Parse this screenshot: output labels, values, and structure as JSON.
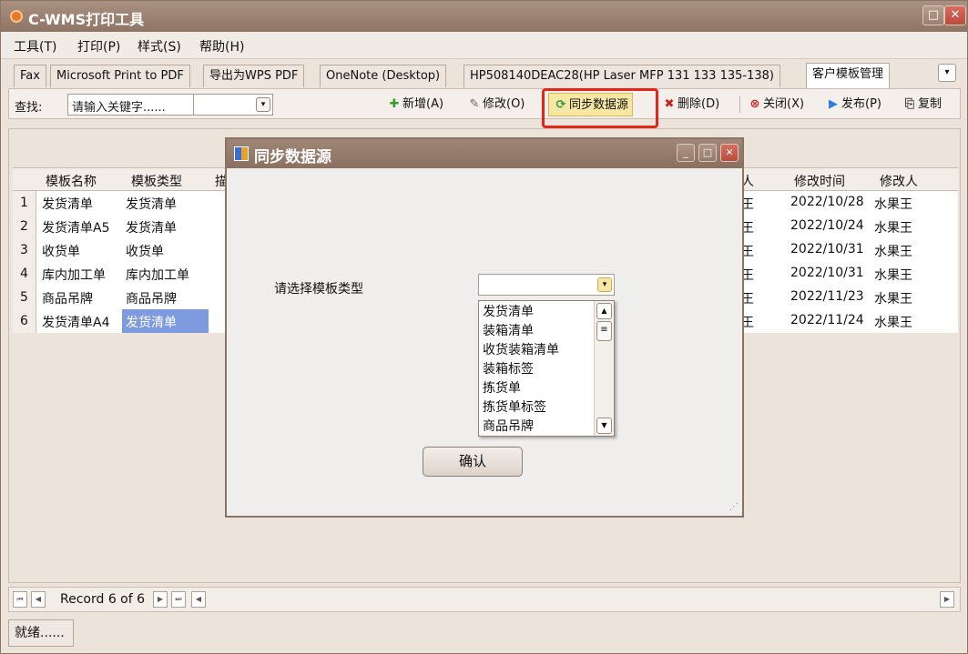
{
  "app": {
    "title": "C-WMS打印工具"
  },
  "menu": [
    "工具(T)",
    "打印(P)",
    "样式(S)",
    "帮助(H)"
  ],
  "tabs": [
    "Fax",
    "Microsoft Print to PDF",
    "导出为WPS PDF",
    "OneNote (Desktop)",
    "HP508140DEAC28(HP Laser MFP 131 133 135-138)",
    "客户模板管理"
  ],
  "toolbar": {
    "find_label": "查找:",
    "search_value": "请输入关键字......",
    "add": "新增(A)",
    "edit": "修改(O)",
    "sync": "同步数据源",
    "delete": "删除(D)",
    "close": "关闭(X)",
    "publish": "发布(P)",
    "copy": "复制"
  },
  "grid": {
    "headers": {
      "name": "模板名称",
      "type": "模板类型",
      "desc": "描",
      "modifier_partial": "人",
      "time": "修改时间",
      "user": "修改人"
    },
    "rows": [
      {
        "n": "1",
        "name": "发货清单",
        "type": "发货清单",
        "mid": "王",
        "time": "2022/10/28",
        "user": "水果王"
      },
      {
        "n": "2",
        "name": "发货清单A5",
        "type": "发货清单",
        "mid": "王",
        "time": "2022/10/24",
        "user": "水果王"
      },
      {
        "n": "3",
        "name": "收货单",
        "type": "收货单",
        "mid": "王",
        "time": "2022/10/31",
        "user": "水果王"
      },
      {
        "n": "4",
        "name": "库内加工单",
        "type": "库内加工单",
        "mid": "王",
        "time": "2022/10/31",
        "user": "水果王"
      },
      {
        "n": "5",
        "name": "商品吊牌",
        "type": "商品吊牌",
        "mid": "王",
        "time": "2022/11/23",
        "user": "水果王"
      },
      {
        "n": "6",
        "name": "发货清单A4",
        "type": "发货清单",
        "mid": "王",
        "time": "2022/11/24",
        "user": "水果王"
      }
    ]
  },
  "navigator": {
    "record_text": "Record 6 of 6"
  },
  "status": {
    "text": "就绪......"
  },
  "dialog": {
    "title": "同步数据源",
    "prompt": "请选择模板类型",
    "combo_value": "",
    "options": [
      "发货清单",
      "装箱清单",
      "收货装箱清单",
      "装箱标签",
      "拣货单",
      "拣货单标签",
      "商品吊牌"
    ],
    "confirm": "确认"
  },
  "colors": {
    "titlebar": "#9a8070",
    "highlight": "#e3261c",
    "selection": "#7f9be0"
  }
}
